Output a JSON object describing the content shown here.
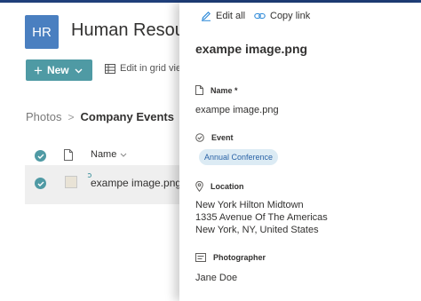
{
  "site": {
    "logo_text": "HR",
    "title": "Human Resources",
    "brand_color": "#4f9aa4"
  },
  "command_bar": {
    "new_label": "New",
    "grid_view_label": "Edit in grid view"
  },
  "breadcrumb": {
    "parent": "Photos",
    "current": "Company Events"
  },
  "list": {
    "name_header": "Name",
    "rows": [
      {
        "name": "exampe image.png",
        "selected": true
      }
    ]
  },
  "details": {
    "edit_all_label": "Edit all",
    "copy_link_label": "Copy link",
    "file_title": "exampe image.png",
    "fields": {
      "name": {
        "label": "Name *",
        "value": "exampe image.png",
        "icon": "document-icon"
      },
      "event": {
        "label": "Event",
        "value": "Annual Conference",
        "icon": "check-circle-icon"
      },
      "location": {
        "label": "Location",
        "lines": [
          "New York Hilton Midtown",
          "1335 Avenue Of The Americas",
          "New York, NY, United States"
        ],
        "icon": "location-pin-icon"
      },
      "photographer": {
        "label": "Photographer",
        "value": "Jane Doe",
        "icon": "person-card-icon"
      }
    }
  }
}
